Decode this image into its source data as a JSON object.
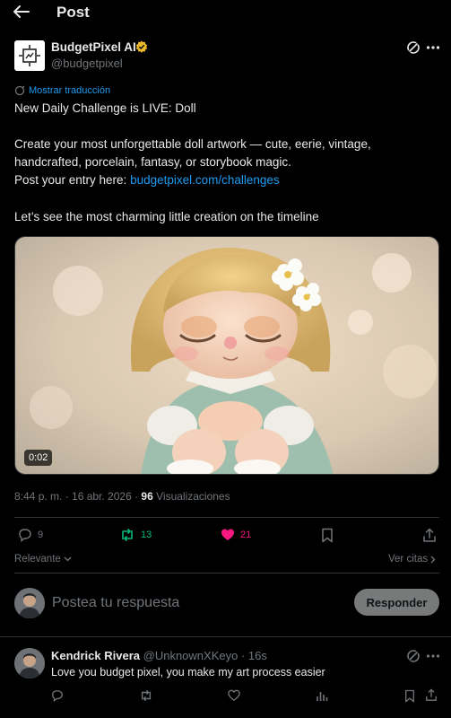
{
  "header": {
    "title": "Post"
  },
  "post": {
    "author_name": "BudgetPixel AI",
    "author_handle": "@budgetpixel",
    "translate_label": "Mostrar traducción",
    "line1": "New Daily Challenge is LIVE: Doll",
    "line2": "Create your most unforgettable doll artwork — cute, eerie, vintage,",
    "line3": "handcrafted, porcelain, fantasy, or storybook magic.",
    "line4_prefix": "Post your entry here: ",
    "line4_link": "budgetpixel.com/challenges",
    "line5": "Let’s see the most charming little creation on the timeline",
    "video_duration": "0:02",
    "timestamp": "8:44 p. m. · 16 abr. 2026 · ",
    "views_count": "96",
    "views_label": " Visualizaciones",
    "replies": "9",
    "reposts": "13",
    "likes": "21",
    "accent_color": "#1d9bf0",
    "repost_color": "#00ba7c",
    "like_color": "#f91880"
  },
  "sort": {
    "label": "Relevante",
    "quotes_label": "Ver citas"
  },
  "composer": {
    "placeholder": "Postea tu respuesta",
    "button_label": "Responder"
  },
  "reply": {
    "author_name": "Kendrick Rivera",
    "author_handle": "@UnknownXKeyo",
    "time": "· 16s",
    "text": "Love you budget pixel, you make my art process easier"
  }
}
